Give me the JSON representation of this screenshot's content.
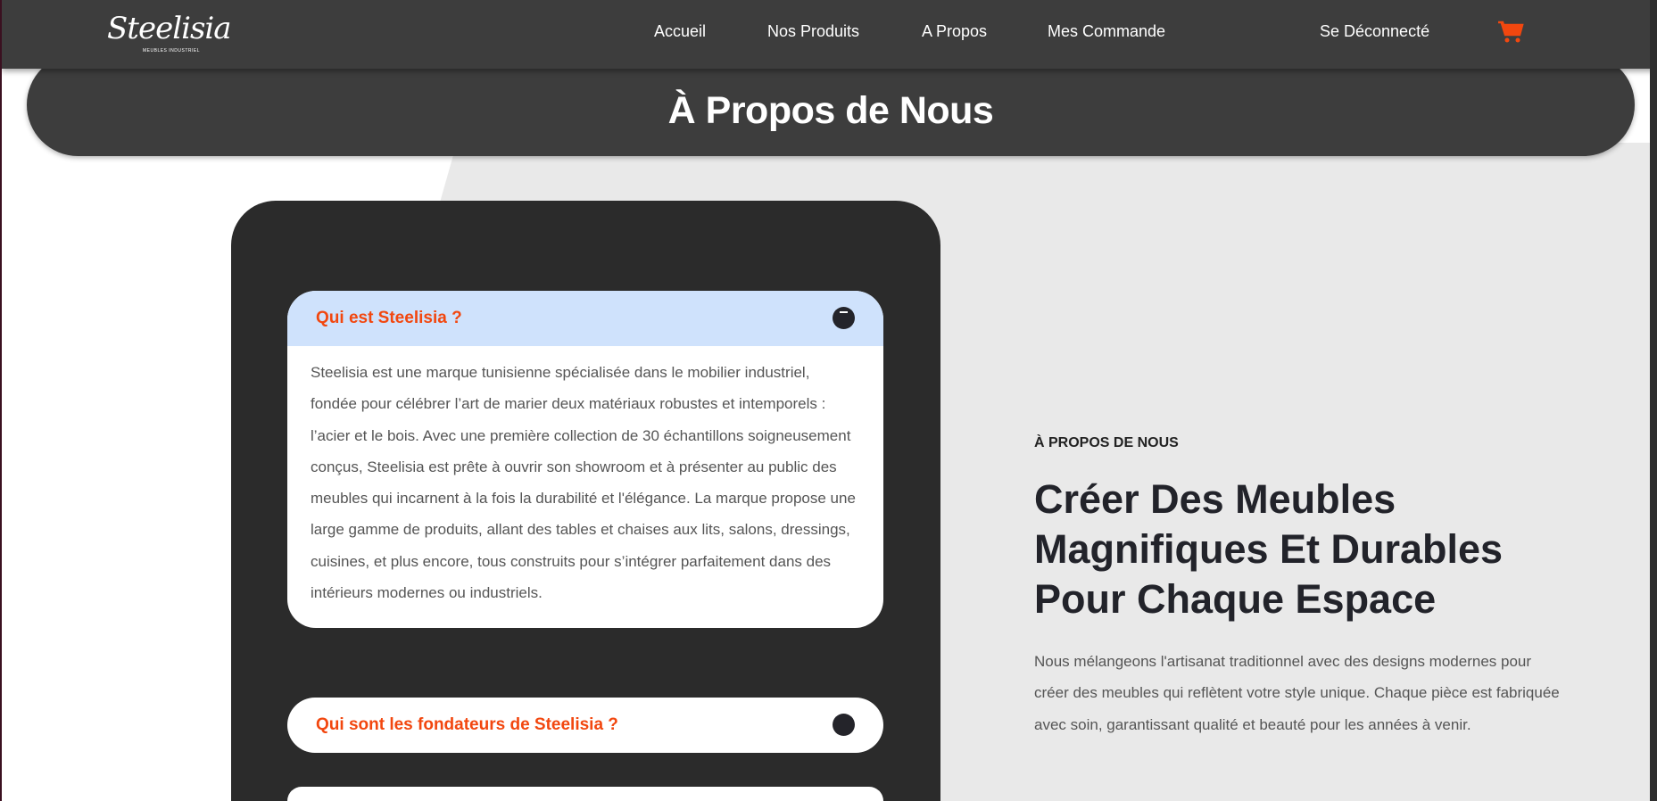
{
  "nav": {
    "logo_text": "Steelisia",
    "logo_sub": "MEUBLES INDUSTRIEL",
    "links": [
      "Accueil",
      "Nos Produits",
      "A Propos",
      "Mes Commande"
    ],
    "logout": "Se Déconnecté",
    "cart_icon": "shopping-cart-icon",
    "cart_color": "#f2470f"
  },
  "hero": {
    "title": "À Propos de Nous"
  },
  "faq": [
    {
      "question": "Qui est Steelisia ?",
      "expanded": true,
      "answer": "Steelisia est une marque tunisienne spécialisée dans le mobilier industriel, fondée pour célébrer l’art de marier deux matériaux robustes et intemporels : l’acier et le bois. Avec une première collection de 30 échantillons soigneusement conçus, Steelisia est prête à ouvrir son showroom et à présenter au public des meubles qui incarnent à la fois la durabilité et l'élégance. La marque propose une large gamme de produits, allant des tables et chaises aux lits, salons, dressings, cuisines, et plus encore, tous construits pour s’intégrer parfaitement dans des intérieurs modernes ou industriels."
    },
    {
      "question": "Qui sont les fondateurs de Steelisia ?",
      "expanded": false
    }
  ],
  "about": {
    "eyebrow": "À PROPOS DE NOUS",
    "heading": "Créer Des Meubles Magnifiques Et Durables Pour Chaque Espace",
    "paragraph": "Nous mélangeons l'artisanat traditionnel avec des designs modernes pour créer des meubles qui reflètent votre style unique. Chaque pièce est fabriquée avec soin, garantissant qualité et beauté pour les années à venir."
  },
  "colors": {
    "accent": "#f2470f",
    "dark": "#3d3d3d",
    "accordion_active": "#cfe2fc"
  }
}
